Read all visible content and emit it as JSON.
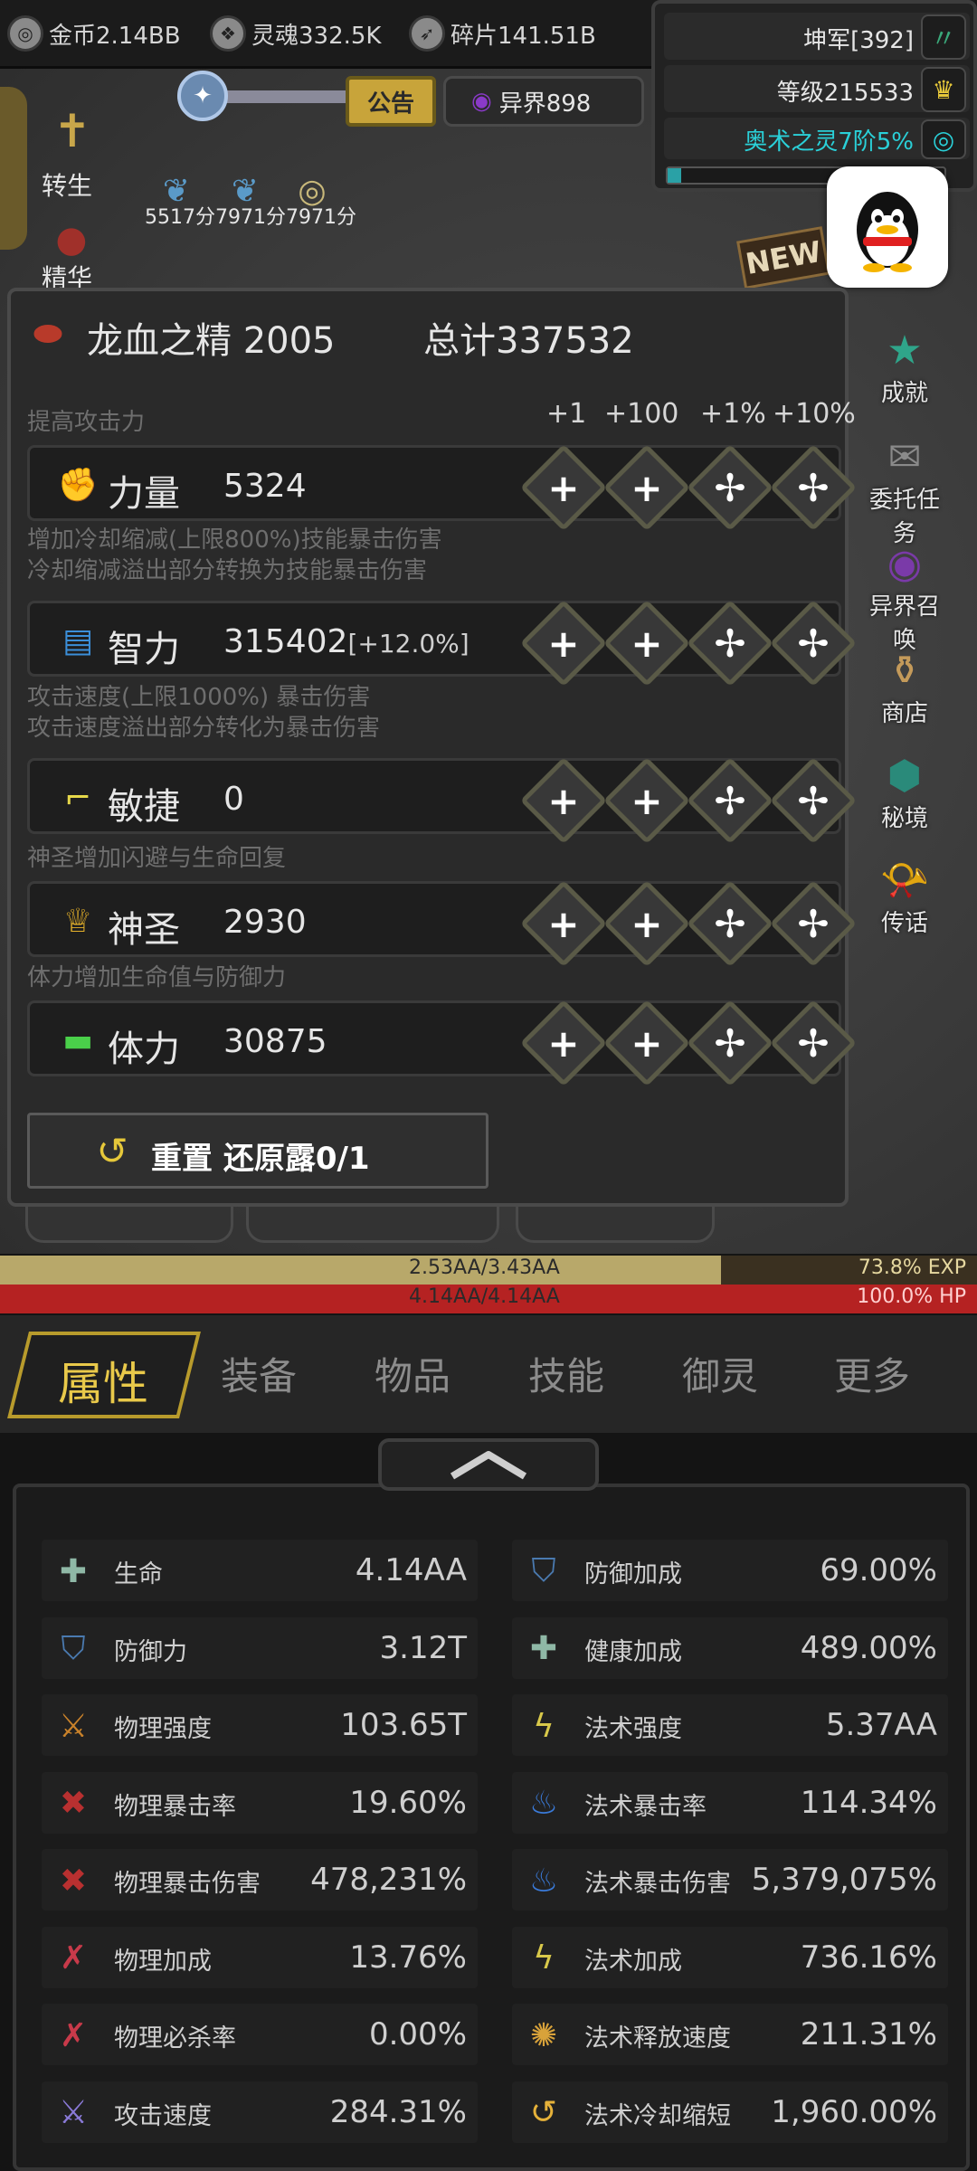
{
  "currencies": [
    {
      "label": "金币2.14BB",
      "icon": "coin-icon"
    },
    {
      "label": "灵魂332.5K",
      "icon": "soul-icon"
    },
    {
      "label": "碎片141.51B",
      "icon": "shard-icon"
    }
  ],
  "player": {
    "name": "坤军[392]",
    "level": "等级215533",
    "spirit": "奥术之灵7阶5%",
    "spirit_progress": 0.05
  },
  "scene": {
    "notice_label": "公告",
    "otherworld_label": "异界898",
    "rebirth_label": "转生",
    "essence_label": "精华",
    "scores": "5517分7971分7971分",
    "new_badge": "NEW"
  },
  "dialog": {
    "item_name": "龙血之精 2005",
    "total": "总计337532",
    "increments": [
      "+1",
      "+100",
      "+1%",
      "+10%"
    ],
    "stats": [
      {
        "desc": [
          "提高攻击力"
        ],
        "name": "力量",
        "value": "5324",
        "bonus": "",
        "icon": "arm-icon",
        "color": "#f0a46a"
      },
      {
        "desc": [
          "增加冷却缩减(上限800%)技能暴击伤害",
          "冷却缩减溢出部分转换为技能暴击伤害"
        ],
        "name": "智力",
        "value": "315402",
        "bonus": "[+12.0%]",
        "icon": "book-icon",
        "color": "#3b8fd9"
      },
      {
        "desc": [
          "攻击速度(上限1000%) 暴击伤害",
          "攻击速度溢出部分转化为暴击伤害"
        ],
        "name": "敏捷",
        "value": "0",
        "bonus": "",
        "icon": "boot-icon",
        "color": "#e6d84a"
      },
      {
        "desc": [
          "神圣增加闪避与生命回复"
        ],
        "name": "神圣",
        "value": "2930",
        "bonus": "",
        "icon": "trophy-icon",
        "color": "#e6b22a"
      },
      {
        "desc": [
          "体力增加生命值与防御力"
        ],
        "name": "体力",
        "value": "30875",
        "bonus": "",
        "icon": "bone-icon",
        "color": "#4ad04a"
      }
    ],
    "reset_label": "重置 还原露0/1"
  },
  "side_menu": [
    {
      "label": "成就",
      "icon": "star-icon",
      "color": "#2fa58a"
    },
    {
      "label": "委托任务",
      "icon": "scroll-icon",
      "color": "#8a8a8a"
    },
    {
      "label": "异界召唤",
      "icon": "portal-icon",
      "color": "#7a3aa8"
    },
    {
      "label": "商店",
      "icon": "shop-icon",
      "color": "#c49a5a"
    },
    {
      "label": "秘境",
      "icon": "realm-icon",
      "color": "#2a8a7a"
    },
    {
      "label": "传话",
      "icon": "horn-icon",
      "color": "#3a9a4a"
    }
  ],
  "bars": {
    "exp_text": "2.53AA/3.43AA",
    "exp_percent": "73.8% EXP",
    "exp_fraction": 0.738,
    "hp_text": "4.14AA/4.14AA",
    "hp_percent": "100.0%   HP"
  },
  "tabs": {
    "active": "属性",
    "others": [
      "装备",
      "物品",
      "技能",
      "御灵",
      "更多"
    ]
  },
  "attributes": [
    {
      "name": "生命",
      "value": "4.14AA",
      "icon": "cross-icon",
      "color": "#8fb8a6"
    },
    {
      "name": "防御加成",
      "value": "69.00%",
      "icon": "shield-icon",
      "color": "#4a7ab0"
    },
    {
      "name": "防御力",
      "value": "3.12T",
      "icon": "shield-icon",
      "color": "#4a7ab0"
    },
    {
      "name": "健康加成",
      "value": "489.00%",
      "icon": "cross-icon",
      "color": "#8fb8a6"
    },
    {
      "name": "物理强度",
      "value": "103.65T",
      "icon": "claw-icon",
      "color": "#c9822a"
    },
    {
      "name": "法术强度",
      "value": "5.37AA",
      "icon": "bolt-icon",
      "color": "#d8c84a"
    },
    {
      "name": "物理暴击率",
      "value": "19.60%",
      "icon": "slash-icon",
      "color": "#b83030"
    },
    {
      "name": "法术暴击率",
      "value": "114.34%",
      "icon": "flame-icon",
      "color": "#3a7ad8"
    },
    {
      "name": "物理暴击伤害",
      "value": "478,231%",
      "icon": "slash-icon",
      "color": "#b83030"
    },
    {
      "name": "法术暴击伤害",
      "value": "5,379,075%",
      "icon": "flame-icon",
      "color": "#3a7ad8"
    },
    {
      "name": "物理加成",
      "value": "13.76%",
      "icon": "sword-icon",
      "color": "#c83a4a"
    },
    {
      "name": "法术加成",
      "value": "736.16%",
      "icon": "bolt-icon",
      "color": "#d8c84a"
    },
    {
      "name": "物理必杀率",
      "value": "0.00%",
      "icon": "sword-icon",
      "color": "#c83a4a"
    },
    {
      "name": "法术释放速度",
      "value": "211.31%",
      "icon": "burst-icon",
      "color": "#d8a23a"
    },
    {
      "name": "攻击速度",
      "value": "284.31%",
      "icon": "swords-icon",
      "color": "#8a7ad8"
    },
    {
      "name": "法术冷却缩短",
      "value": "1,960.00%",
      "icon": "cooldown-icon",
      "color": "#e6b23a"
    }
  ]
}
